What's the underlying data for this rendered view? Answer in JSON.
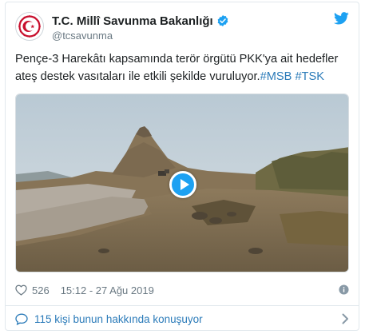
{
  "account": {
    "display_name": "T.C. Millî Savunma Bakanlığı",
    "handle": "@tcsavunma",
    "verified": true
  },
  "tweet": {
    "text": "Pençe-3 Harekâtı kapsamında terör örgütü PKK'ya ait hedefler ateş destek vasıtaları ile etkili şekilde vuruluyor.",
    "hashtags": [
      "#MSB",
      "#TSK"
    ]
  },
  "media": {
    "type": "video",
    "play_icon": "play-icon"
  },
  "meta": {
    "likes": "526",
    "timestamp": "15:12 - 27 Ağu 2019"
  },
  "footer": {
    "conversation_text": "115 kişi bunun hakkında konuşuyor"
  },
  "icons": {
    "brand": "twitter-bird-icon",
    "verified": "verified-badge-icon",
    "like": "heart-icon",
    "info": "info-icon",
    "reply": "speech-bubble-icon",
    "more": "chevron-right-icon"
  },
  "colors": {
    "brand_blue": "#1da1f2",
    "link_blue": "#2b7bb9",
    "text": "#1c2022",
    "muted": "#697882",
    "logo_red": "#c8102e"
  }
}
